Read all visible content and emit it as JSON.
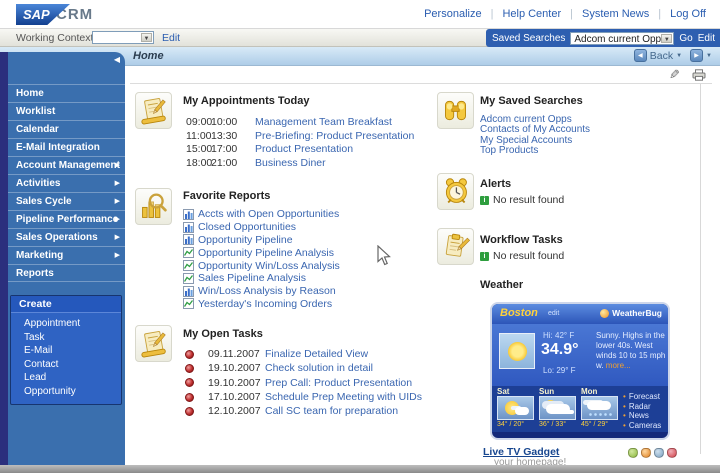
{
  "header": {
    "logo_sap": "SAP",
    "logo_crm": "CRM",
    "links": [
      "Personalize",
      "Help Center",
      "System News",
      "Log Off"
    ]
  },
  "toolbar": {
    "working_context_label": "Working Context",
    "working_context_value": "",
    "working_context_edit": "Edit",
    "saved_searches_label": "Saved Searches",
    "saved_searches_value": "Adcom current Opps",
    "go_label": "Go",
    "edit_label": "Edit"
  },
  "titlebar": {
    "title": "Home",
    "back_label": "Back"
  },
  "sidebar": {
    "items": [
      {
        "label": "Home",
        "arrow": false
      },
      {
        "label": "Worklist",
        "arrow": false
      },
      {
        "label": "Calendar",
        "arrow": false
      },
      {
        "label": "E-Mail Integration",
        "arrow": false
      },
      {
        "label": "Account Management",
        "arrow": true
      },
      {
        "label": "Activities",
        "arrow": true
      },
      {
        "label": "Sales Cycle",
        "arrow": true
      },
      {
        "label": "Pipeline Performance",
        "arrow": true
      },
      {
        "label": "Sales Operations",
        "arrow": true
      },
      {
        "label": "Marketing",
        "arrow": true
      },
      {
        "label": "Reports",
        "arrow": false
      }
    ],
    "create": {
      "header": "Create",
      "items": [
        "Appointment",
        "Task",
        "E-Mail",
        "Contact",
        "Lead",
        "Opportunity"
      ]
    }
  },
  "main": {
    "appointments": {
      "title": "My Appointments Today",
      "rows": [
        {
          "start": "09:00",
          "end": "10:00",
          "label": "Management Team Breakfast"
        },
        {
          "start": "11:00",
          "end": "13:30",
          "label": "Pre-Briefing: Product Presentation"
        },
        {
          "start": "15:00",
          "end": "17:00",
          "label": "Product Presentation"
        },
        {
          "start": "18:00",
          "end": "21:00",
          "label": "Business Diner"
        }
      ]
    },
    "favorite_reports": {
      "title": "Favorite Reports",
      "items": [
        {
          "icon": "bar-chart",
          "label": "Accts with Open Opportunities"
        },
        {
          "icon": "bar-chart",
          "label": "Closed Opportunities"
        },
        {
          "icon": "bar-chart",
          "label": "Opportunity Pipeline"
        },
        {
          "icon": "line-chart",
          "label": "Opportunity Pipeline Analysis"
        },
        {
          "icon": "line-chart",
          "label": "Opportunity Win/Loss Analysis"
        },
        {
          "icon": "line-chart",
          "label": "Sales Pipeline Analysis"
        },
        {
          "icon": "bar-chart",
          "label": "Win/Loss Analysis by Reason"
        },
        {
          "icon": "line-chart",
          "label": "Yesterday's Incoming Orders"
        }
      ]
    },
    "open_tasks": {
      "title": "My Open Tasks",
      "rows": [
        {
          "date": "09.11.2007",
          "label": "Finalize Detailed View"
        },
        {
          "date": "19.10.2007",
          "label": "Check solution in detail"
        },
        {
          "date": "19.10.2007",
          "label": "Prep Call: Product Presentation"
        },
        {
          "date": "17.10.2007",
          "label": "Schedule Prep Meeting with UIDs"
        },
        {
          "date": "12.10.2007",
          "label": "Call SC team for preparation"
        }
      ]
    },
    "saved_searches": {
      "title": "My Saved Searches",
      "items": [
        "Adcom current Opps",
        "Contacts of My Accounts",
        "My Special Accounts",
        "Top Products"
      ]
    },
    "alerts": {
      "title": "Alerts",
      "empty_text": "No result found"
    },
    "workflow_tasks": {
      "title": "Workflow Tasks",
      "empty_text": "No result found"
    },
    "weather": {
      "title": "Weather",
      "city": "Boston",
      "edit_label": "edit",
      "brand": "WeatherBug",
      "hi": "Hi: 42° F",
      "temp_now": "34.9°",
      "lo": "Lo: 29° F",
      "description": "Sunny. Highs in the lower 40s. West winds 10 to 15 mph w.",
      "more_label": "more...",
      "forecast": [
        {
          "day": "Sat",
          "temps": "34° / 20°",
          "icon": "sun-cloud"
        },
        {
          "day": "Sun",
          "temps": "36° / 33°",
          "icon": "clouds"
        },
        {
          "day": "Mon",
          "temps": "45° / 29°",
          "icon": "rain"
        }
      ],
      "links": [
        "Forecast",
        "Radar",
        "News",
        "Cameras"
      ],
      "footer_link": "Live TV Gadget",
      "footer_text": "your homepage!"
    }
  },
  "icons": {
    "dropdown_arrow": "▼",
    "collapse_arrow": "◀",
    "submenu_arrow": "▶",
    "back_arrow": "◀",
    "forward_arrow": "▶",
    "pencil": "✎",
    "info": "i"
  },
  "colors": {
    "sidebar": "#3a6fae",
    "sidebar_edge": "#2b2f7d",
    "create_panel": "#2f63c3",
    "create_header": "#2558bc",
    "saved_searches_bar": "#2e5fb0",
    "titlebar_from": "#d8eaf7",
    "titlebar_to": "#aecde8",
    "link": "#3a66b0",
    "heading": "#222222",
    "weather_dark": "#1d3f96",
    "weather_accent": "#ffd23c"
  }
}
